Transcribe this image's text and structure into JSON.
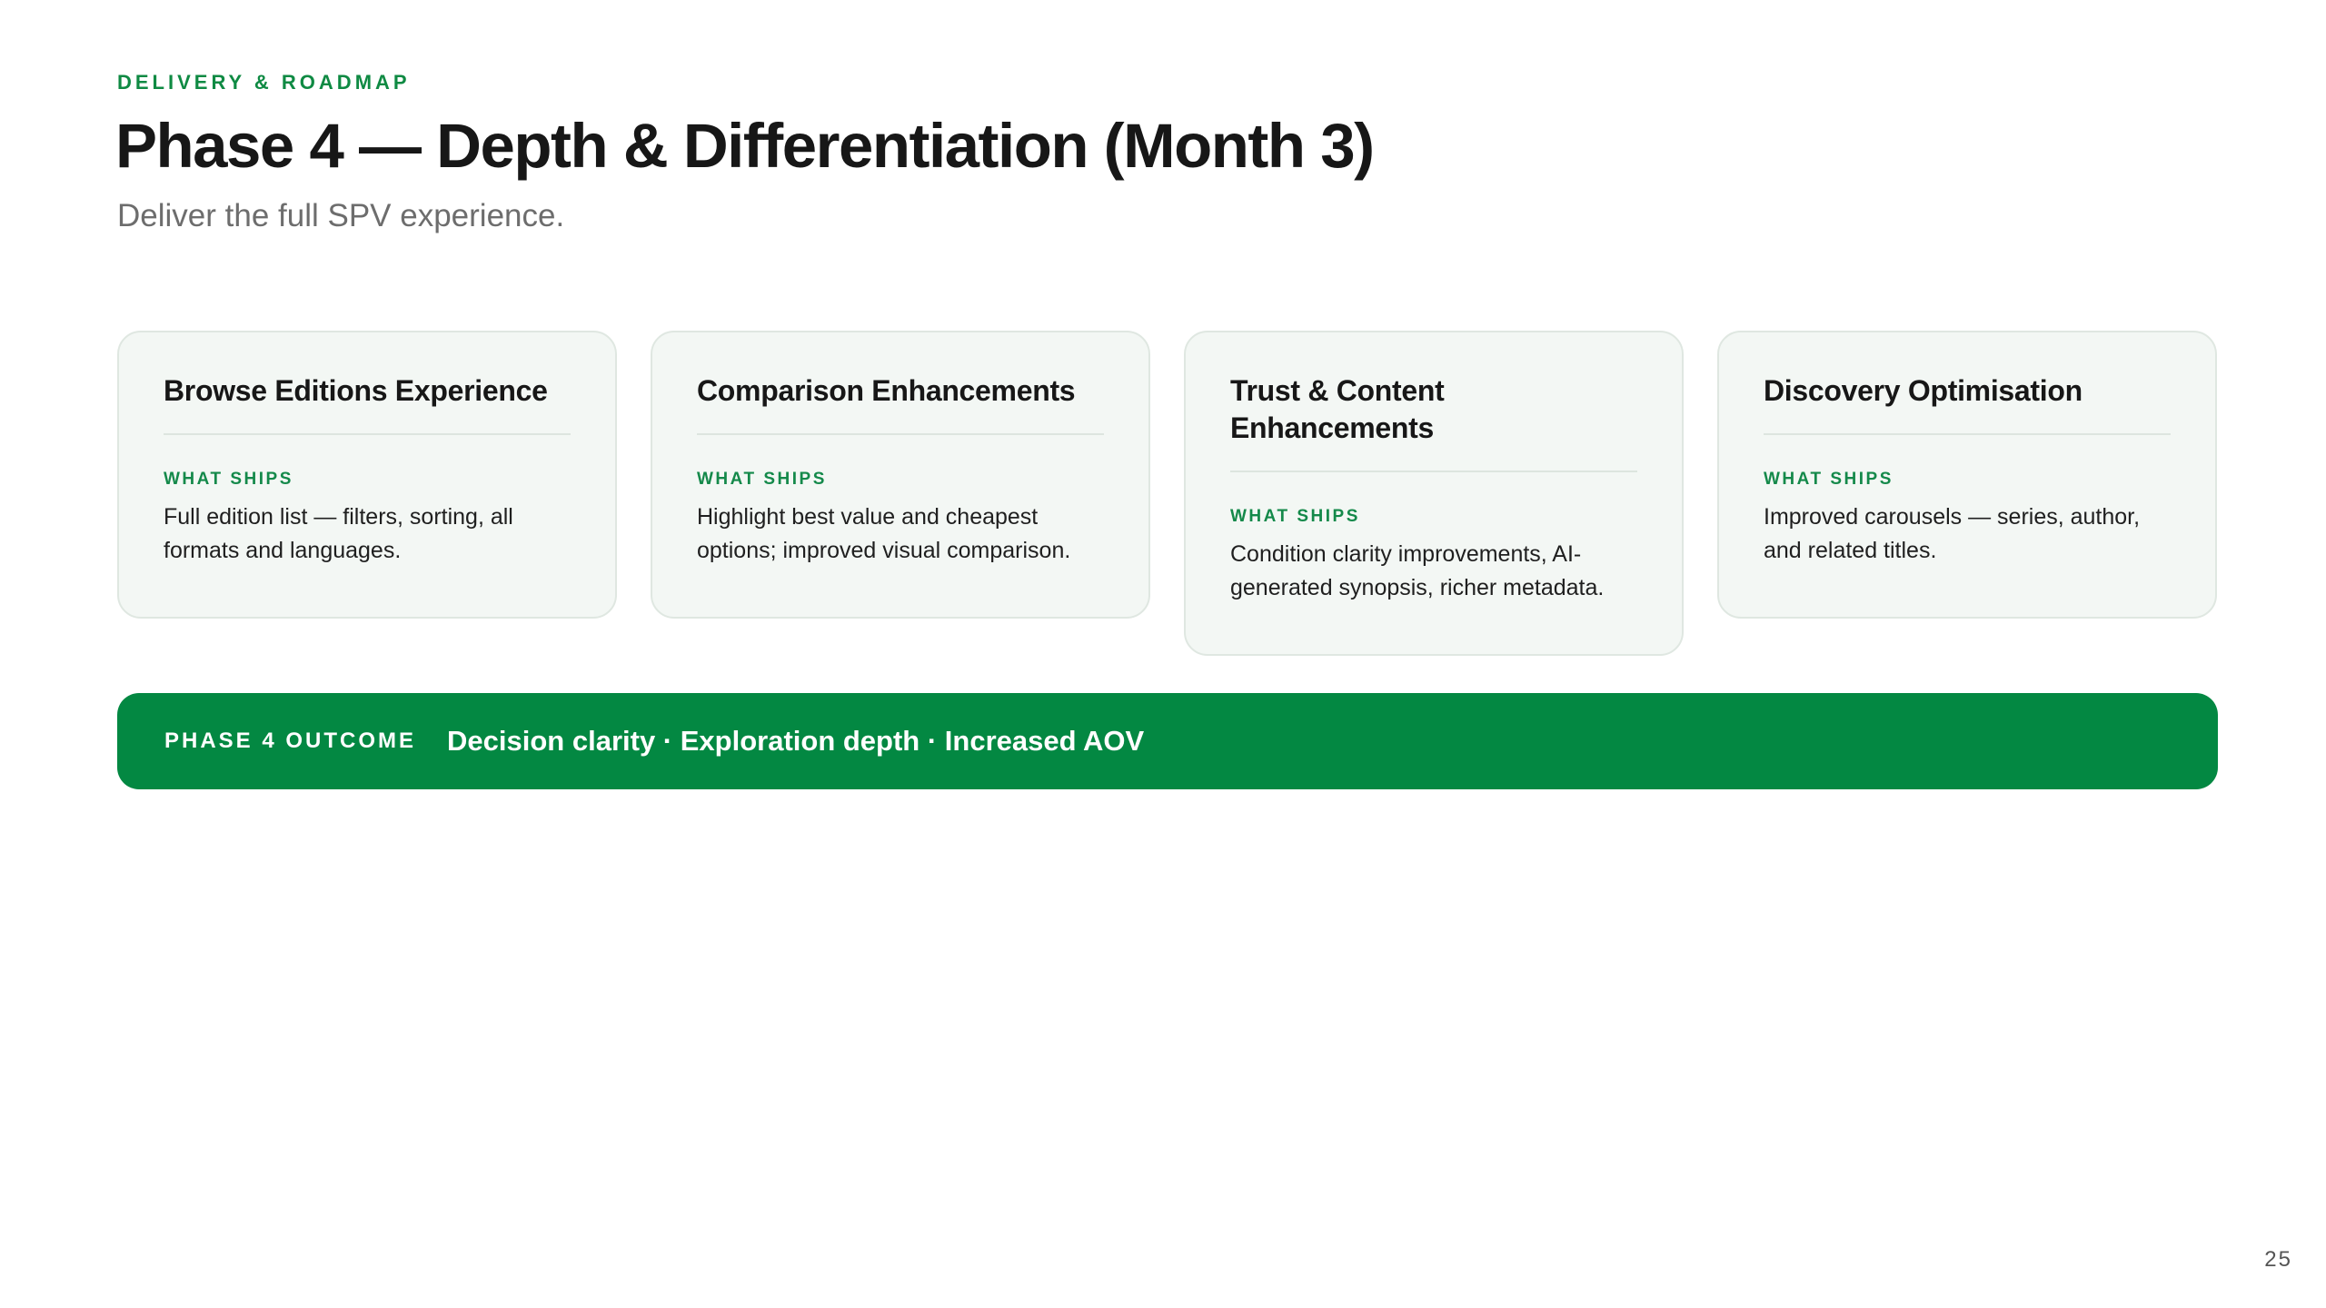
{
  "header": {
    "eyebrow": "DELIVERY & ROADMAP",
    "title": "Phase 4 — Depth & Differentiation (Month 3)",
    "subtitle": "Deliver the full SPV experience."
  },
  "cards": [
    {
      "title": "Browse Editions Experience",
      "ships_label": "WHAT SHIPS",
      "ships_text": "Full edition list — filters, sorting, all formats and languages."
    },
    {
      "title": "Comparison Enhancements",
      "ships_label": "WHAT SHIPS",
      "ships_text": "Highlight best value and cheapest options; improved visual comparison."
    },
    {
      "title": "Trust & Content Enhancements",
      "ships_label": "WHAT SHIPS",
      "ships_text": "Condition clarity improvements, AI-generated synopsis, richer metadata."
    },
    {
      "title": "Discovery Optimisation",
      "ships_label": "WHAT SHIPS",
      "ships_text": "Improved carousels — series, author, and related titles."
    }
  ],
  "outcome": {
    "label": "PHASE 4 OUTCOME",
    "text": "Decision clarity · Exploration depth · Increased AOV"
  },
  "page_number": "25",
  "colors": {
    "accent_green": "#038842",
    "label_green": "#0f8a43",
    "card_background": "#f3f7f4"
  }
}
